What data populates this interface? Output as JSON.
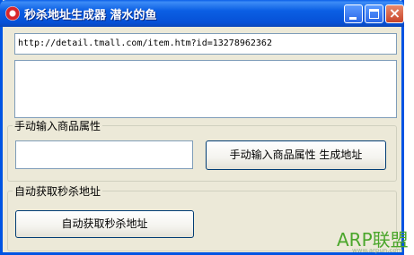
{
  "window": {
    "title": "秒杀地址生成器 潜水的鱼"
  },
  "url_input": {
    "value": "http://detail.tmall.com/item.htm?id=13278962362"
  },
  "result_area": {
    "value": ""
  },
  "manual_group": {
    "label": "手动输入商品属性",
    "input_value": "",
    "button_label": "手动输入商品属性 生成地址"
  },
  "auto_group": {
    "label": "自动获取秒杀地址",
    "button_label": "自动获取秒杀地址"
  },
  "watermark": {
    "text": "ARP联盟",
    "sub": "www.arpun.com"
  },
  "colors": {
    "titlebar": "#0650d6",
    "window_bg": "#ece9d8",
    "watermark": "#4aa62b"
  }
}
